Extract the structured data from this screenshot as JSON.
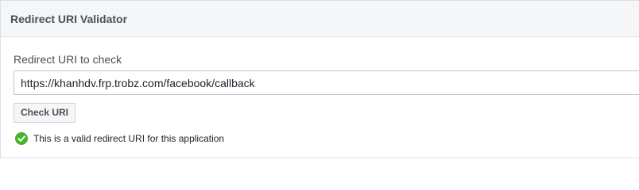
{
  "panel": {
    "title": "Redirect URI Validator"
  },
  "form": {
    "label": "Redirect URI to check",
    "input_value": "https://khanhdv.frp.trobz.com/facebook/callback",
    "button_label": "Check URI"
  },
  "result": {
    "icon": "check-circle-icon",
    "message": "This is a valid redirect URI for this application",
    "color": "#42b72a"
  }
}
